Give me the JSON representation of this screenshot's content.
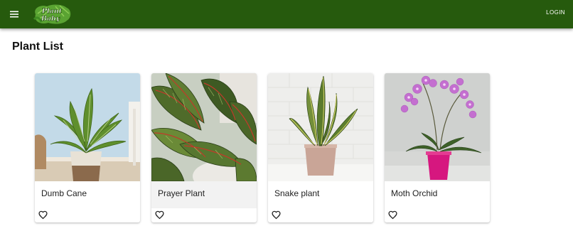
{
  "header": {
    "logo_line1": "Plant",
    "logo_line2": "Baby",
    "login_label": "LOGIN",
    "bar_color": "#265a0d"
  },
  "page": {
    "title": "Plant List"
  },
  "plants": [
    {
      "name": "Dumb Cane"
    },
    {
      "name": "Prayer Plant"
    },
    {
      "name": "Snake plant"
    },
    {
      "name": "Moth Orchid"
    }
  ],
  "icons": {
    "menu": "hamburger-menu-icon",
    "favorite": "heart-outline-icon"
  }
}
